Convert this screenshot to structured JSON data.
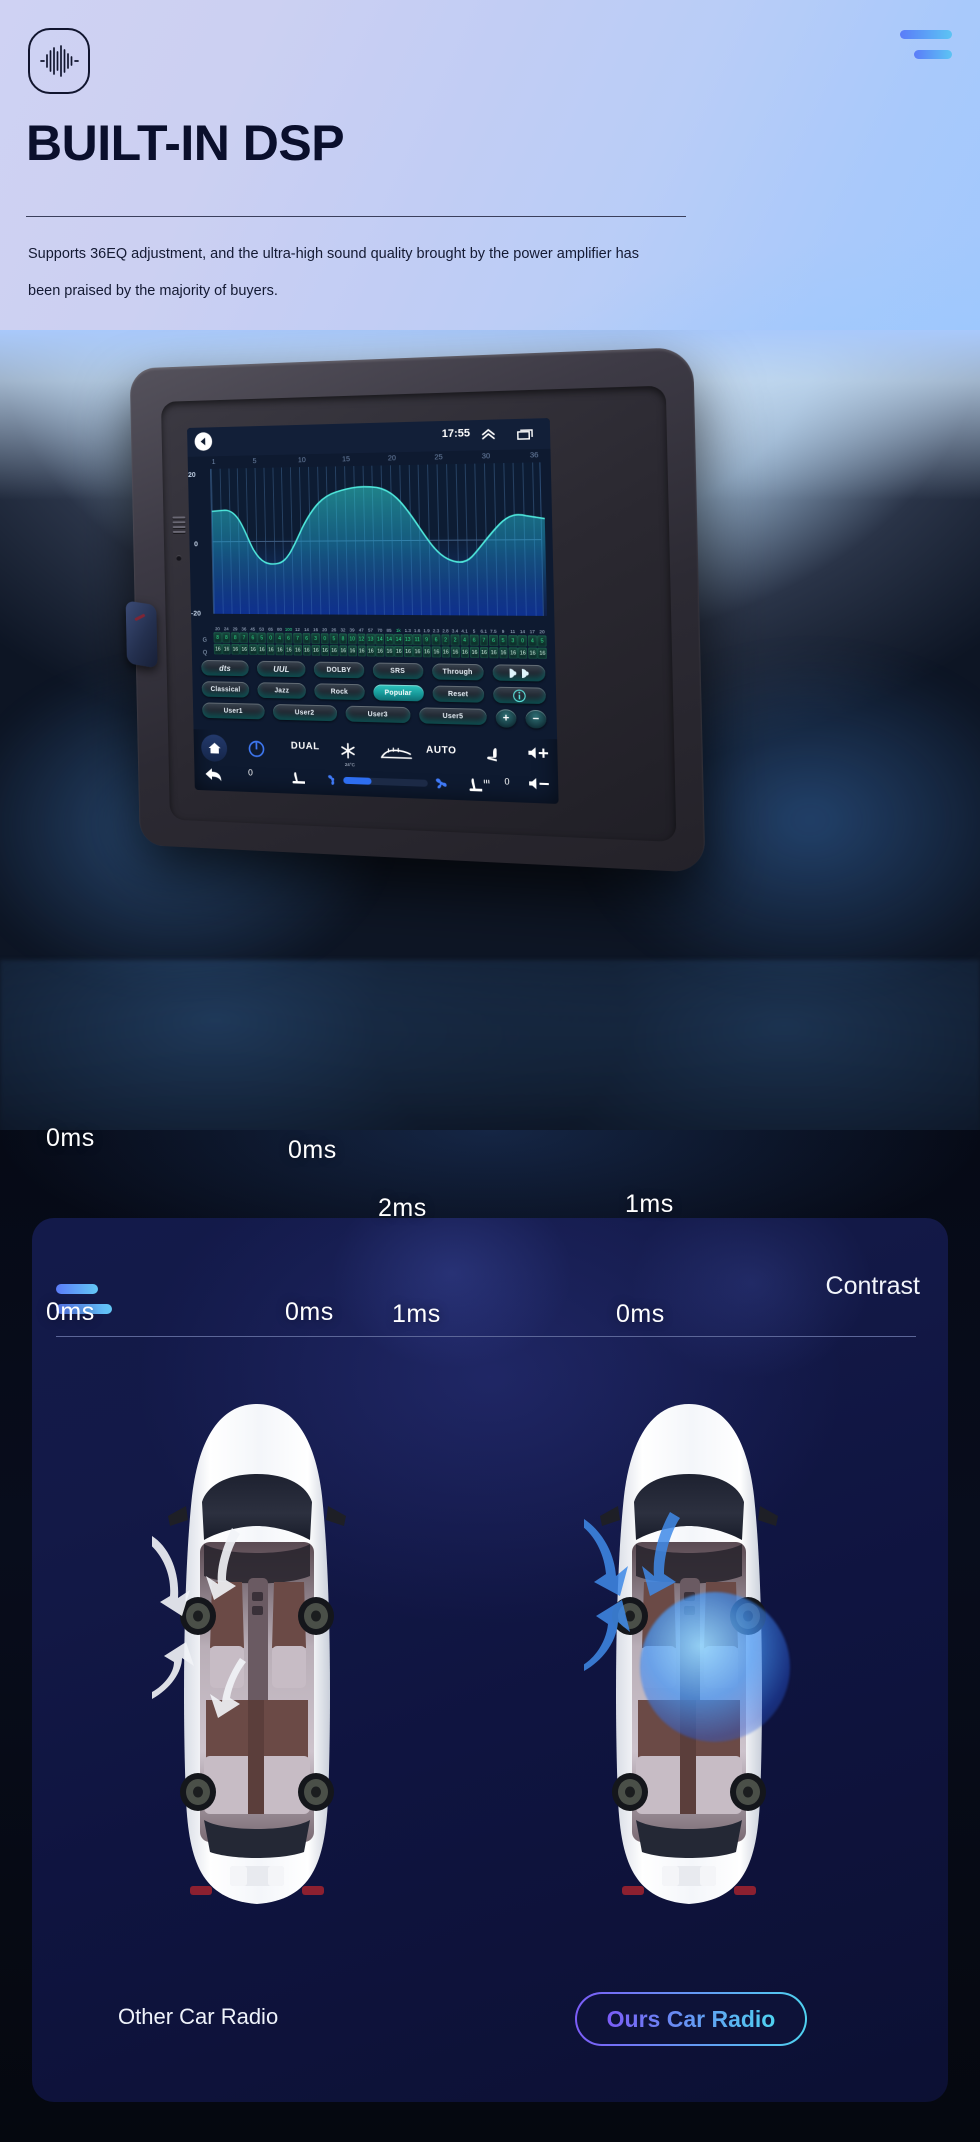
{
  "hero": {
    "logo_icon": "audio-waveform-icon",
    "menu_icon": "hamburger-icon",
    "title": "BUILT-IN DSP",
    "subtitle": "Supports 36EQ adjustment, and the ultra-high sound quality brought by the power amplifier has been praised by the majority of buyers."
  },
  "radio_screen": {
    "status": {
      "back_icon": "back-arrow-icon",
      "time": "17:55",
      "chevron_icon": "chevron-up-icon",
      "recent_icon": "recent-apps-icon"
    },
    "eq": {
      "x_ticks": [
        "1",
        "5",
        "10",
        "15",
        "20",
        "25",
        "30",
        "36"
      ],
      "y_ticks": [
        "20",
        "0",
        "-20"
      ],
      "freq_labels": [
        "20",
        "24",
        "29",
        "36",
        "45",
        "53",
        "65",
        "80",
        "100",
        "12",
        "14",
        "16",
        "20",
        "26",
        "32",
        "39",
        "47",
        "57",
        "70",
        "85",
        "1k",
        "1.3",
        "1.6",
        "1.9",
        "2.3",
        "2.8",
        "3.4",
        "4.1",
        "5",
        "6.1",
        "7.5",
        "9",
        "11",
        "14",
        "17",
        "20"
      ],
      "freq_highlight_index": [
        8,
        20
      ],
      "g_row_label": "G",
      "q_row_label": "Q",
      "g_values": [
        "8",
        "8",
        "8",
        "7",
        "6",
        "5",
        "0",
        "4",
        "6",
        "7",
        "6",
        "3",
        "0",
        "5",
        "8",
        "10",
        "12",
        "13",
        "14",
        "14",
        "14",
        "13",
        "11",
        "9",
        "6",
        "2",
        "2",
        "4",
        "6",
        "7",
        "6",
        "5",
        "3",
        "0",
        "4",
        "5"
      ],
      "q_values": [
        "16",
        "16",
        "16",
        "16",
        "16",
        "16",
        "16",
        "16",
        "16",
        "16",
        "16",
        "16",
        "16",
        "16",
        "16",
        "16",
        "16",
        "16",
        "16",
        "16",
        "16",
        "16",
        "16",
        "16",
        "16",
        "16",
        "16",
        "16",
        "16",
        "16",
        "16",
        "16",
        "16",
        "16",
        "16",
        "16"
      ]
    },
    "presets": {
      "row1": [
        "dts",
        "UUL",
        "DOLBY",
        "SRS",
        "Through",
        "balance-icon"
      ],
      "row2": [
        "Classical",
        "Jazz",
        "Rock",
        "Popular",
        "Reset",
        "info-icon"
      ],
      "row3": [
        "User1",
        "User2",
        "User3",
        "User5",
        "+",
        "−"
      ],
      "active": "Popular"
    },
    "climate": {
      "home_icon": "home-icon",
      "power_icon": "power-icon",
      "dual_label": "DUAL",
      "ac_icon": "snowflake-icon",
      "defrost_icon": "rear-defrost-icon",
      "auto_label": "AUTO",
      "seat_icon": "seat-icon",
      "temperature": "24°C",
      "back_icon": "back-arrow-icon",
      "left_temp": "0",
      "right_temp": "0",
      "vol_up_icon": "volume-up-icon",
      "vol_down_icon": "volume-down-icon",
      "recline_icon": "seat-recline-icon",
      "fan_low_icon": "fan-low-icon",
      "fan_high_icon": "fan-high-icon",
      "heated_seat_icon": "heated-seat-icon"
    }
  },
  "contrast": {
    "menu_icon": "hamburger-icon",
    "title": "Contrast",
    "left_car": {
      "label": "Other Car Radio",
      "delays": {
        "front_left": "0ms",
        "front_right": "0ms",
        "rear_left": "0ms",
        "rear_right": "0ms"
      }
    },
    "right_car": {
      "label": "Ours Car Radio",
      "delays": {
        "front_left": "2ms",
        "front_right": "1ms",
        "rear_left": "1ms",
        "rear_right": "0ms"
      }
    }
  },
  "colors": {
    "accent_blue": "#5b7cf8",
    "accent_cyan": "#4fd2f0",
    "accent_purple": "#7b5cf7",
    "eq_line": "#4fe0d8",
    "panel_bg": "#131a4a",
    "title_dark": "#0a0f2c"
  }
}
